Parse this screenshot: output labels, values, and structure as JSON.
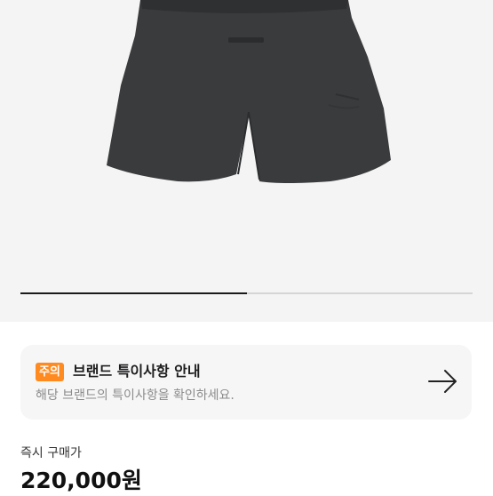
{
  "product": {
    "image_icon": "shorts-image",
    "image_progress": 0.5
  },
  "notice": {
    "badge": "주의",
    "title": "브랜드 특이사항 안내",
    "description": "해당 브랜드의 특이사항을 확인하세요.",
    "arrow_icon": "arrow-right-icon",
    "badge_color": "#ff8a1f"
  },
  "price": {
    "label": "즉시 구매가",
    "value": "220,000원"
  }
}
